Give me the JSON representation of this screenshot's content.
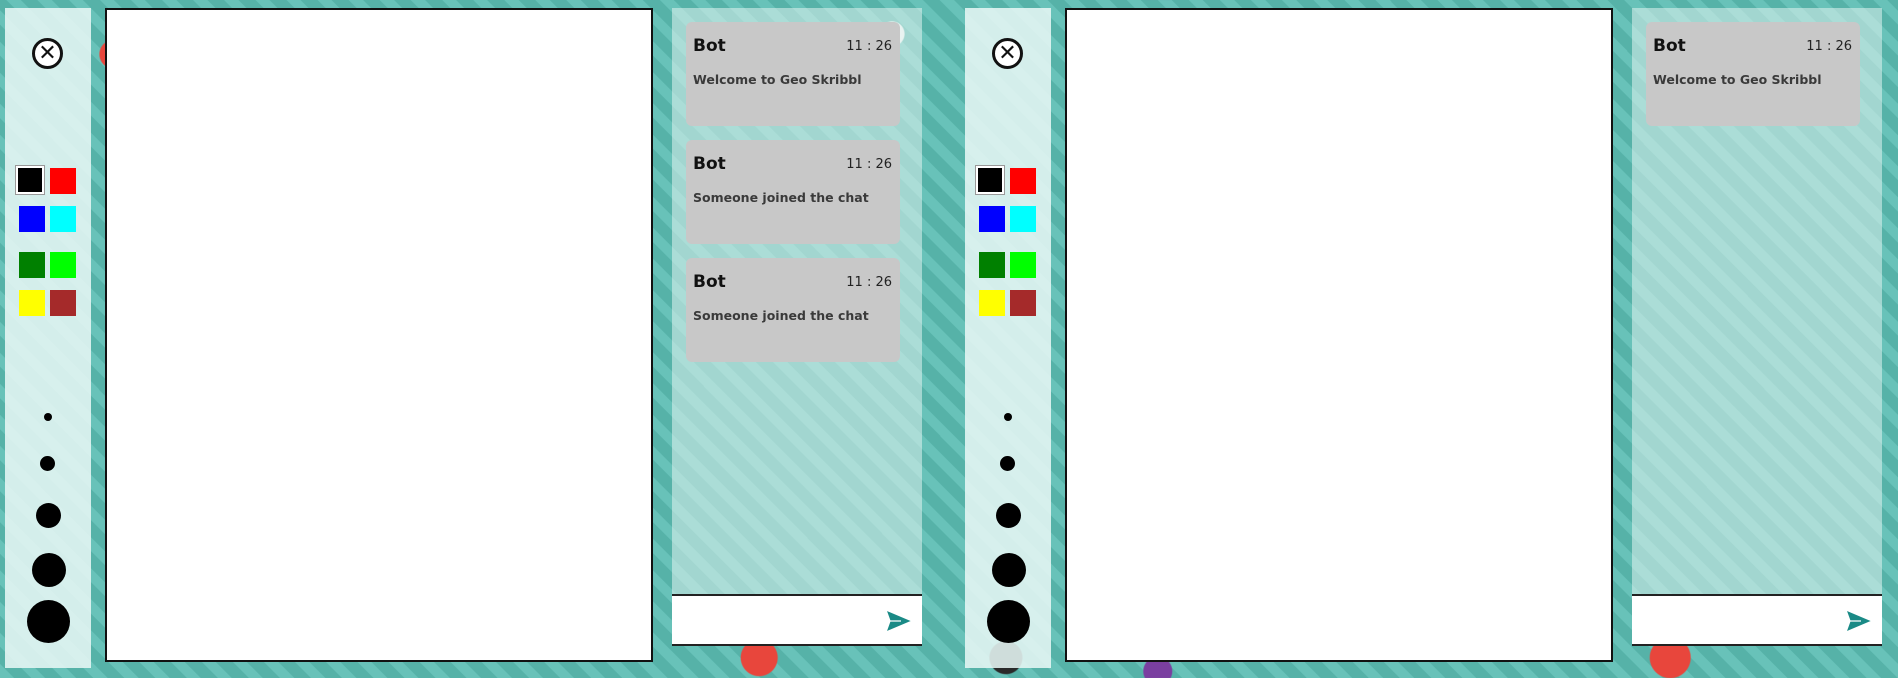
{
  "panels": [
    {
      "toolbar": {
        "close_glyph": "✕",
        "colors": [
          "#000000",
          "#ff0000",
          "#0000ff",
          "#00ffff",
          "#008000",
          "#00ff00",
          "#ffff00",
          "#a52a2a"
        ],
        "selected_color": "#000000",
        "brush_sizes": [
          "xs",
          "s",
          "m",
          "l",
          "xl"
        ]
      },
      "chat": {
        "messages": [
          {
            "author": "Bot",
            "time": "11 : 26",
            "text": "Welcome to Geo Skribbl"
          },
          {
            "author": "Bot",
            "time": "11 : 26",
            "text": "Someone joined the chat"
          },
          {
            "author": "Bot",
            "time": "11 : 26",
            "text": "Someone joined the chat"
          }
        ],
        "input_value": "",
        "input_placeholder": ""
      }
    },
    {
      "toolbar": {
        "close_glyph": "✕",
        "colors": [
          "#000000",
          "#ff0000",
          "#0000ff",
          "#00ffff",
          "#008000",
          "#00ff00",
          "#ffff00",
          "#a52a2a"
        ],
        "selected_color": "#000000",
        "brush_sizes": [
          "xs",
          "s",
          "m",
          "l",
          "xl"
        ]
      },
      "chat": {
        "messages": [
          {
            "author": "Bot",
            "time": "11 : 26",
            "text": "Welcome to Geo Skribbl"
          }
        ],
        "input_value": "",
        "input_placeholder": ""
      }
    }
  ],
  "theme": {
    "send_icon_color": "#1a8a86"
  }
}
